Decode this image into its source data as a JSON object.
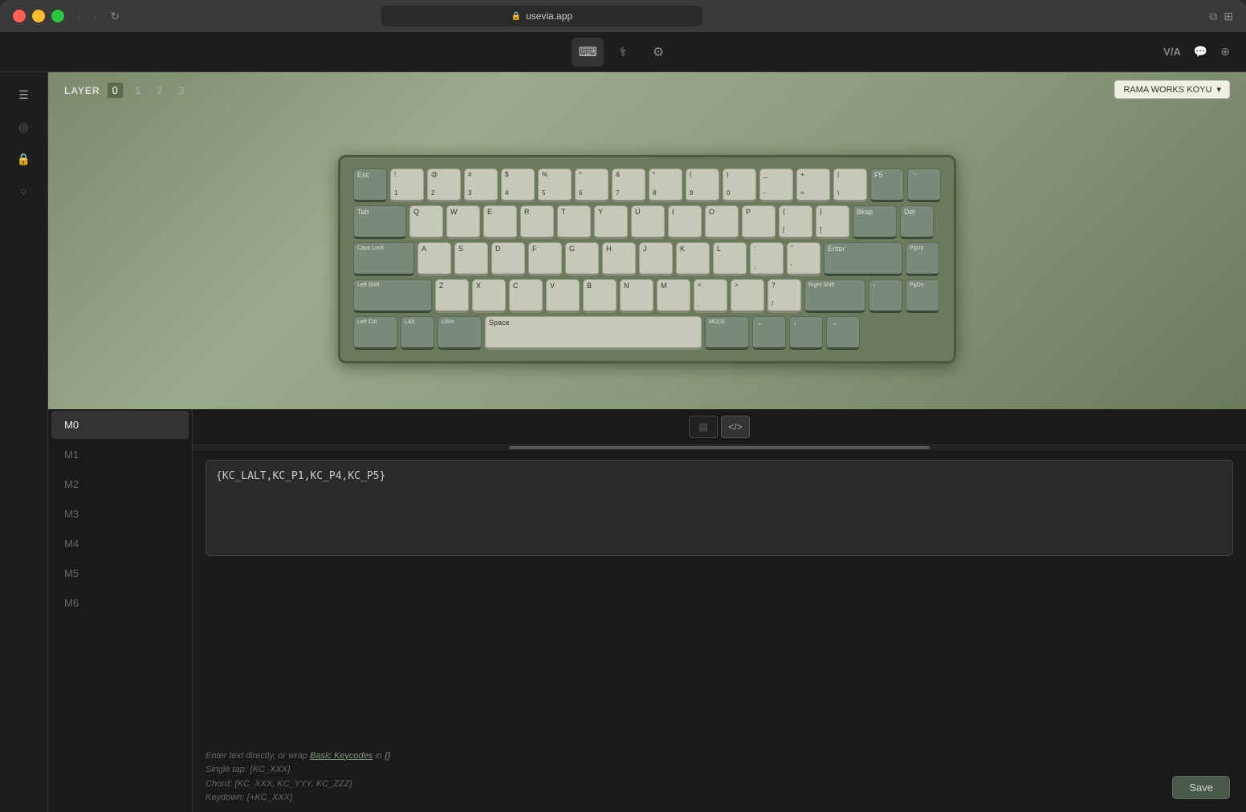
{
  "browser": {
    "url": "usevia.app",
    "lock_icon": "🔒"
  },
  "app": {
    "title": "VIA",
    "tabs": [
      {
        "id": "keyboard",
        "icon": "⌨",
        "active": true
      },
      {
        "id": "debug",
        "icon": "⚕"
      },
      {
        "id": "settings",
        "icon": "⚙"
      }
    ],
    "header_right": [
      "V/A",
      "💬",
      "⊕"
    ]
  },
  "layer_bar": {
    "label": "LAYER",
    "layers": [
      "0",
      "1",
      "2",
      "3"
    ],
    "active": "0"
  },
  "keyboard": {
    "brand": "RAMA WORKS KOYU",
    "rows": [
      {
        "keys": [
          {
            "label": "Esc",
            "width": "w1",
            "dark": true
          },
          {
            "top": "!",
            "bot": "1",
            "width": "w1"
          },
          {
            "top": "@",
            "bot": "2",
            "width": "w1"
          },
          {
            "top": "#",
            "bot": "3",
            "width": "w1"
          },
          {
            "top": "$",
            "bot": "4",
            "width": "w1"
          },
          {
            "top": "%",
            "bot": "5",
            "width": "w1"
          },
          {
            "top": "^",
            "bot": "6",
            "width": "w1"
          },
          {
            "top": "&",
            "bot": "7",
            "width": "w1"
          },
          {
            "top": "*",
            "bot": "8",
            "width": "w1"
          },
          {
            "top": "(",
            "bot": "9",
            "width": "w1"
          },
          {
            "top": ")",
            "bot": "0",
            "width": "w1"
          },
          {
            "top": "_",
            "bot": "-",
            "width": "w1"
          },
          {
            "top": "+",
            "bot": "=",
            "width": "w1"
          },
          {
            "top": "|",
            "bot": "\\",
            "width": "w1"
          },
          {
            "label": "F5",
            "width": "w1",
            "dark": true
          },
          {
            "label": "`~",
            "width": "w1",
            "dark": true
          }
        ]
      },
      {
        "keys": [
          {
            "label": "Tab",
            "width": "w15",
            "dark": true
          },
          {
            "label": "Q",
            "width": "w1"
          },
          {
            "label": "W",
            "width": "w1"
          },
          {
            "label": "E",
            "width": "w1"
          },
          {
            "label": "R",
            "width": "w1"
          },
          {
            "label": "T",
            "width": "w1"
          },
          {
            "label": "Y",
            "width": "w1"
          },
          {
            "label": "U",
            "width": "w1"
          },
          {
            "label": "I",
            "width": "w1"
          },
          {
            "label": "O",
            "width": "w1"
          },
          {
            "label": "P",
            "width": "w1"
          },
          {
            "top": "{",
            "bot": "[",
            "width": "w1"
          },
          {
            "top": "}",
            "bot": "]",
            "width": "w1"
          },
          {
            "label": "Bksp",
            "width": "w125",
            "dark": true
          },
          {
            "label": "Del",
            "width": "w1",
            "dark": true
          }
        ]
      },
      {
        "keys": [
          {
            "label": "Caps Lock",
            "width": "w175",
            "dark": true
          },
          {
            "label": "A",
            "width": "w1"
          },
          {
            "label": "S",
            "width": "w1"
          },
          {
            "label": "D",
            "width": "w1"
          },
          {
            "label": "F",
            "width": "w1"
          },
          {
            "label": "G",
            "width": "w1"
          },
          {
            "label": "H",
            "width": "w1"
          },
          {
            "label": "J",
            "width": "w1"
          },
          {
            "label": "K",
            "width": "w1"
          },
          {
            "label": "L",
            "width": "w1"
          },
          {
            "top": ":",
            "bot": ";",
            "width": "w1"
          },
          {
            "top": "\"",
            "bot": "'",
            "width": "w1"
          },
          {
            "label": "Enter",
            "width": "w225",
            "dark": true
          },
          {
            "label": "PgUp",
            "width": "w1",
            "dark": true
          }
        ]
      },
      {
        "keys": [
          {
            "label": "Left Shift",
            "width": "w225",
            "dark": true
          },
          {
            "label": "Z",
            "width": "w1"
          },
          {
            "label": "X",
            "width": "w1"
          },
          {
            "label": "C",
            "width": "w1"
          },
          {
            "label": "V",
            "width": "w1"
          },
          {
            "label": "B",
            "width": "w1"
          },
          {
            "label": "N",
            "width": "w1"
          },
          {
            "label": "M",
            "width": "w1"
          },
          {
            "top": "<",
            "bot": ",",
            "width": "w1"
          },
          {
            "top": ">",
            "bot": ".",
            "width": "w1"
          },
          {
            "top": "?",
            "bot": "/",
            "width": "w1"
          },
          {
            "label": "Right Shift",
            "width": "w175r",
            "dark": true
          },
          {
            "label": "↑",
            "width": "w1",
            "dark": true
          },
          {
            "label": "PgDn",
            "width": "w1",
            "dark": true
          }
        ]
      },
      {
        "keys": [
          {
            "label": "Left Ctrl",
            "width": "w125",
            "dark": true
          },
          {
            "label": "LAlt",
            "width": "w1",
            "dark": true
          },
          {
            "label": "LWin",
            "width": "w125",
            "dark": true
          },
          {
            "label": "Space",
            "width": "w625"
          },
          {
            "label": "MO(3)",
            "width": "w125",
            "dark": true
          },
          {
            "label": "←",
            "width": "w1",
            "dark": true
          },
          {
            "label": "↓",
            "width": "w1",
            "dark": true
          },
          {
            "label": "→",
            "width": "w1",
            "dark": true
          }
        ]
      }
    ]
  },
  "macro_panel": {
    "tabs": [
      {
        "id": "sequence",
        "icon": "▤",
        "active": false
      },
      {
        "id": "code",
        "icon": "</>",
        "active": true
      }
    ],
    "macros": [
      {
        "id": "M0",
        "active": true
      },
      {
        "id": "M1"
      },
      {
        "id": "M2"
      },
      {
        "id": "M3"
      },
      {
        "id": "M4"
      },
      {
        "id": "M5"
      },
      {
        "id": "M6"
      }
    ],
    "editor_content": "{KC_LALT,KC_P1,KC_P4,KC_P5}",
    "hints": [
      "Enter text directly, or wrap Basic Keycodes in {}",
      "Single tap: {KC_XXX}",
      "Chord: {KC_XXX, KC_YYY, KC_ZZZ}",
      "Keydown: {+KC_XXX}"
    ],
    "hints_link": "Basic Keycodes",
    "save_label": "Save"
  },
  "sidebar_icons": [
    {
      "id": "document",
      "icon": "☰"
    },
    {
      "id": "target",
      "icon": "◎"
    },
    {
      "id": "lock",
      "icon": "🔒"
    },
    {
      "id": "bulb",
      "icon": "○"
    }
  ]
}
